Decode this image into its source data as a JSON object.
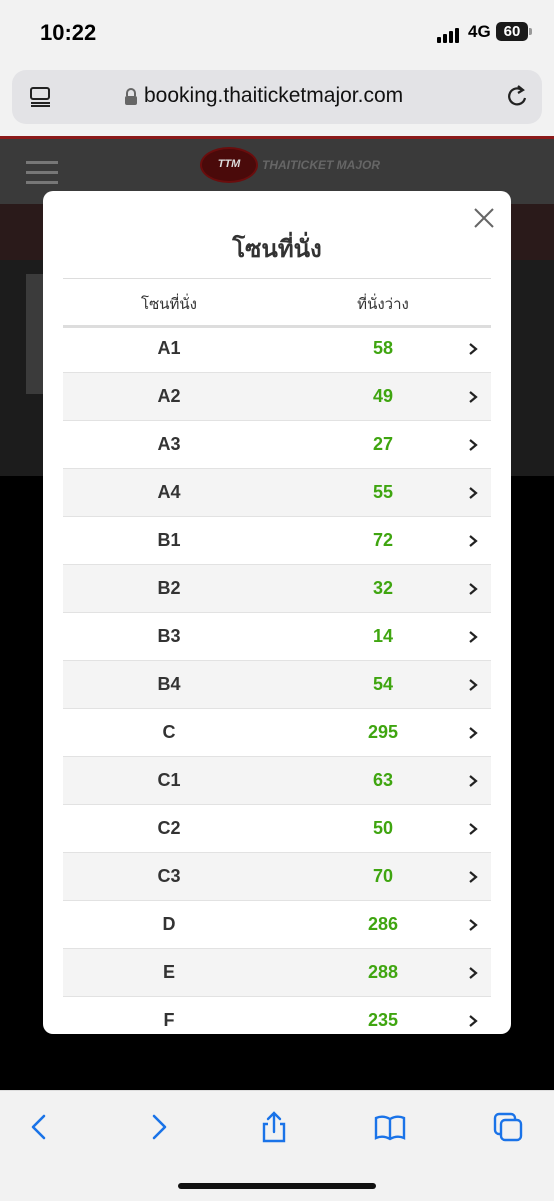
{
  "status_bar": {
    "time": "10:22",
    "network": "4G",
    "battery": "60"
  },
  "browser": {
    "url": "booking.thaiticketmajor.com"
  },
  "site": {
    "logo_text": "THAITICKET MAJOR"
  },
  "modal": {
    "title": "โซนที่นั่ง",
    "headers": {
      "zone": "โซนที่นั่ง",
      "available": "ที่นั่งว่าง"
    },
    "rows": [
      {
        "zone": "A1",
        "available": "58"
      },
      {
        "zone": "A2",
        "available": "49"
      },
      {
        "zone": "A3",
        "available": "27"
      },
      {
        "zone": "A4",
        "available": "55"
      },
      {
        "zone": "B1",
        "available": "72"
      },
      {
        "zone": "B2",
        "available": "32"
      },
      {
        "zone": "B3",
        "available": "14"
      },
      {
        "zone": "B4",
        "available": "54"
      },
      {
        "zone": "C",
        "available": "295"
      },
      {
        "zone": "C1",
        "available": "63"
      },
      {
        "zone": "C2",
        "available": "50"
      },
      {
        "zone": "C3",
        "available": "70"
      },
      {
        "zone": "D",
        "available": "286"
      },
      {
        "zone": "E",
        "available": "288"
      },
      {
        "zone": "F",
        "available": "235"
      }
    ]
  },
  "toolbar": {
    "icons": [
      "back-icon",
      "forward-icon",
      "share-icon",
      "bookmarks-icon",
      "tabs-icon"
    ]
  },
  "colors": {
    "available_green": "#3fa510",
    "ios_blue": "#1a73e8"
  }
}
